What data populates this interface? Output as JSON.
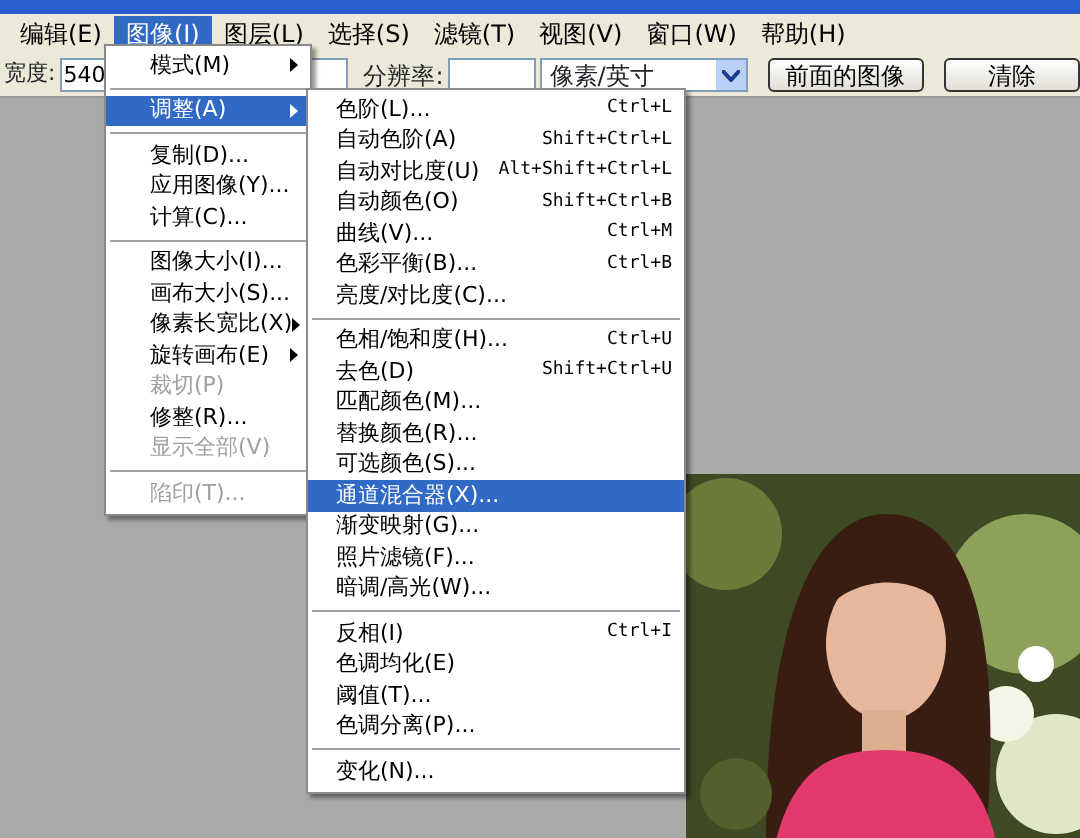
{
  "menu_bar": [
    {
      "label": "编辑(E)",
      "selected": false
    },
    {
      "label": "图像(I)",
      "selected": true
    },
    {
      "label": "图层(L)",
      "selected": false
    },
    {
      "label": "选择(S)",
      "selected": false
    },
    {
      "label": "滤镜(T)",
      "selected": false
    },
    {
      "label": "视图(V)",
      "selected": false
    },
    {
      "label": "窗口(W)",
      "selected": false
    },
    {
      "label": "帮助(H)",
      "selected": false
    }
  ],
  "options_bar": {
    "width_label": "宽度:",
    "width_value": "540",
    "resolution_label": "分辨率:",
    "unit_select": "像素/英寸",
    "buttons": [
      "前面的图像",
      "清除"
    ]
  },
  "image_menu": [
    {
      "kind": "item",
      "label": "模式(M)",
      "submenu": true,
      "disabled": false,
      "selected": false
    },
    {
      "kind": "separator"
    },
    {
      "kind": "item",
      "label": "调整(A)",
      "submenu": true,
      "disabled": false,
      "selected": true
    },
    {
      "kind": "separator"
    },
    {
      "kind": "item",
      "label": "复制(D)...",
      "submenu": false,
      "disabled": false,
      "selected": false
    },
    {
      "kind": "item",
      "label": "应用图像(Y)...",
      "submenu": false,
      "disabled": false,
      "selected": false
    },
    {
      "kind": "item",
      "label": "计算(C)...",
      "submenu": false,
      "disabled": false,
      "selected": false
    },
    {
      "kind": "separator"
    },
    {
      "kind": "item",
      "label": "图像大小(I)...",
      "submenu": false,
      "disabled": false,
      "selected": false
    },
    {
      "kind": "item",
      "label": "画布大小(S)...",
      "submenu": false,
      "disabled": false,
      "selected": false
    },
    {
      "kind": "item",
      "label": "像素长宽比(X)",
      "submenu": true,
      "disabled": false,
      "selected": false
    },
    {
      "kind": "item",
      "label": "旋转画布(E)",
      "submenu": true,
      "disabled": false,
      "selected": false
    },
    {
      "kind": "item",
      "label": "裁切(P)",
      "submenu": false,
      "disabled": true,
      "selected": false
    },
    {
      "kind": "item",
      "label": "修整(R)...",
      "submenu": false,
      "disabled": false,
      "selected": false
    },
    {
      "kind": "item",
      "label": "显示全部(V)",
      "submenu": false,
      "disabled": true,
      "selected": false
    },
    {
      "kind": "separator"
    },
    {
      "kind": "item",
      "label": "陷印(T)...",
      "submenu": false,
      "disabled": true,
      "selected": false
    }
  ],
  "adjust_menu": [
    {
      "kind": "item",
      "label": "色阶(L)...",
      "shortcut": "Ctrl+L",
      "selected": false
    },
    {
      "kind": "item",
      "label": "自动色阶(A)",
      "shortcut": "Shift+Ctrl+L",
      "selected": false
    },
    {
      "kind": "item",
      "label": "自动对比度(U)",
      "shortcut": "Alt+Shift+Ctrl+L",
      "selected": false
    },
    {
      "kind": "item",
      "label": "自动颜色(O)",
      "shortcut": "Shift+Ctrl+B",
      "selected": false
    },
    {
      "kind": "item",
      "label": "曲线(V)...",
      "shortcut": "Ctrl+M",
      "selected": false
    },
    {
      "kind": "item",
      "label": "色彩平衡(B)...",
      "shortcut": "Ctrl+B",
      "selected": false
    },
    {
      "kind": "item",
      "label": "亮度/对比度(C)...",
      "selected": false
    },
    {
      "kind": "separator"
    },
    {
      "kind": "item",
      "label": "色相/饱和度(H)...",
      "shortcut": "Ctrl+U",
      "selected": false
    },
    {
      "kind": "item",
      "label": "去色(D)",
      "shortcut": "Shift+Ctrl+U",
      "selected": false
    },
    {
      "kind": "item",
      "label": "匹配颜色(M)...",
      "selected": false
    },
    {
      "kind": "item",
      "label": "替换颜色(R)...",
      "selected": false
    },
    {
      "kind": "item",
      "label": "可选颜色(S)...",
      "selected": false
    },
    {
      "kind": "item",
      "label": "通道混合器(X)...",
      "selected": true
    },
    {
      "kind": "item",
      "label": "渐变映射(G)...",
      "selected": false
    },
    {
      "kind": "item",
      "label": "照片滤镜(F)...",
      "selected": false
    },
    {
      "kind": "item",
      "label": "暗调/高光(W)...",
      "selected": false
    },
    {
      "kind": "separator"
    },
    {
      "kind": "item",
      "label": "反相(I)",
      "shortcut": "Ctrl+I",
      "selected": false
    },
    {
      "kind": "item",
      "label": "色调均化(E)",
      "selected": false
    },
    {
      "kind": "item",
      "label": "阈值(T)...",
      "selected": false
    },
    {
      "kind": "item",
      "label": "色调分离(P)...",
      "selected": false
    },
    {
      "kind": "separator"
    },
    {
      "kind": "item",
      "label": "变化(N)...",
      "selected": false
    }
  ]
}
